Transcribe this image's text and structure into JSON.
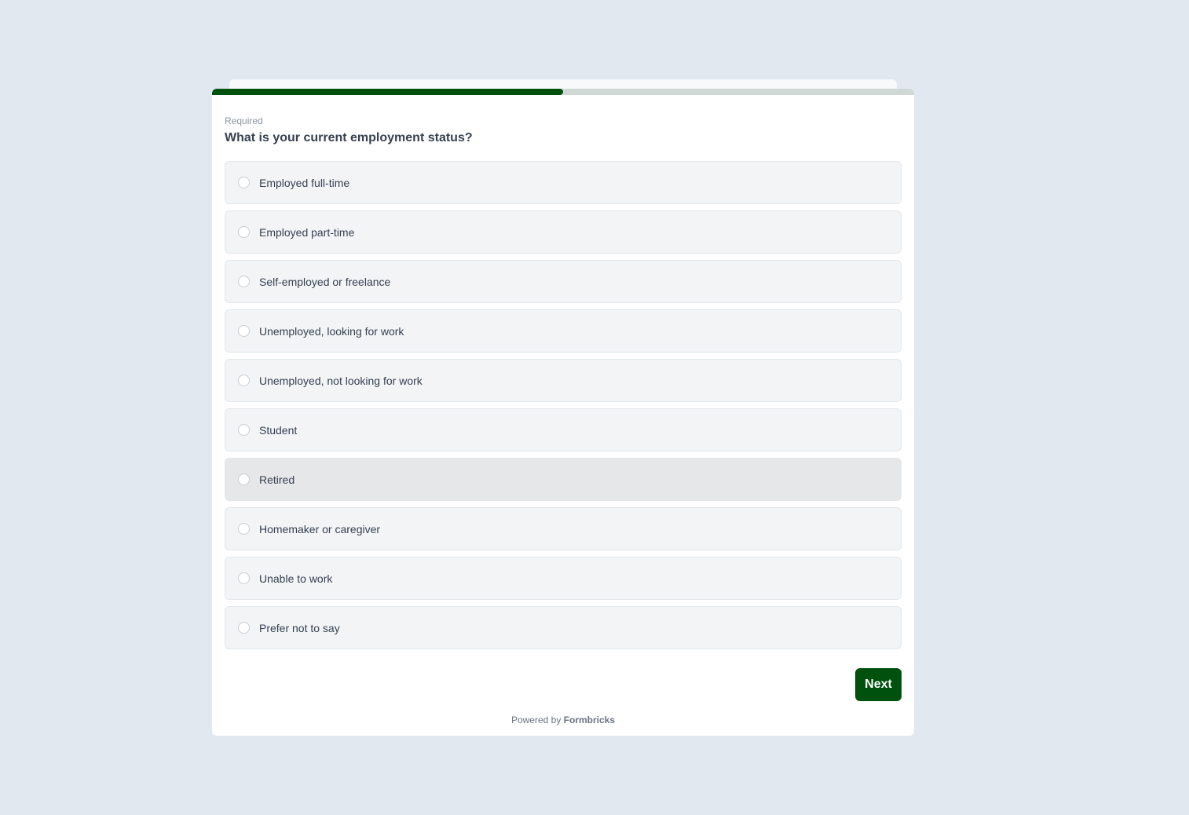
{
  "survey": {
    "progress_percent": 50,
    "required_label": "Required",
    "question": "What is your current employment status?",
    "options": [
      "Employed full-time",
      "Employed part-time",
      "Self-employed or freelance",
      "Unemployed, looking for work",
      "Unemployed, not looking for work",
      "Student",
      "Retired",
      "Homemaker or caregiver",
      "Unable to work",
      "Prefer not to say"
    ],
    "hovered_option": "Retired",
    "next_label": "Next"
  },
  "footer": {
    "powered_prefix": "Powered by",
    "brand": "Formbricks"
  },
  "colors": {
    "brand": "#00510e",
    "background": "#e2e8f0",
    "option_bg": "#f2f4f6"
  }
}
